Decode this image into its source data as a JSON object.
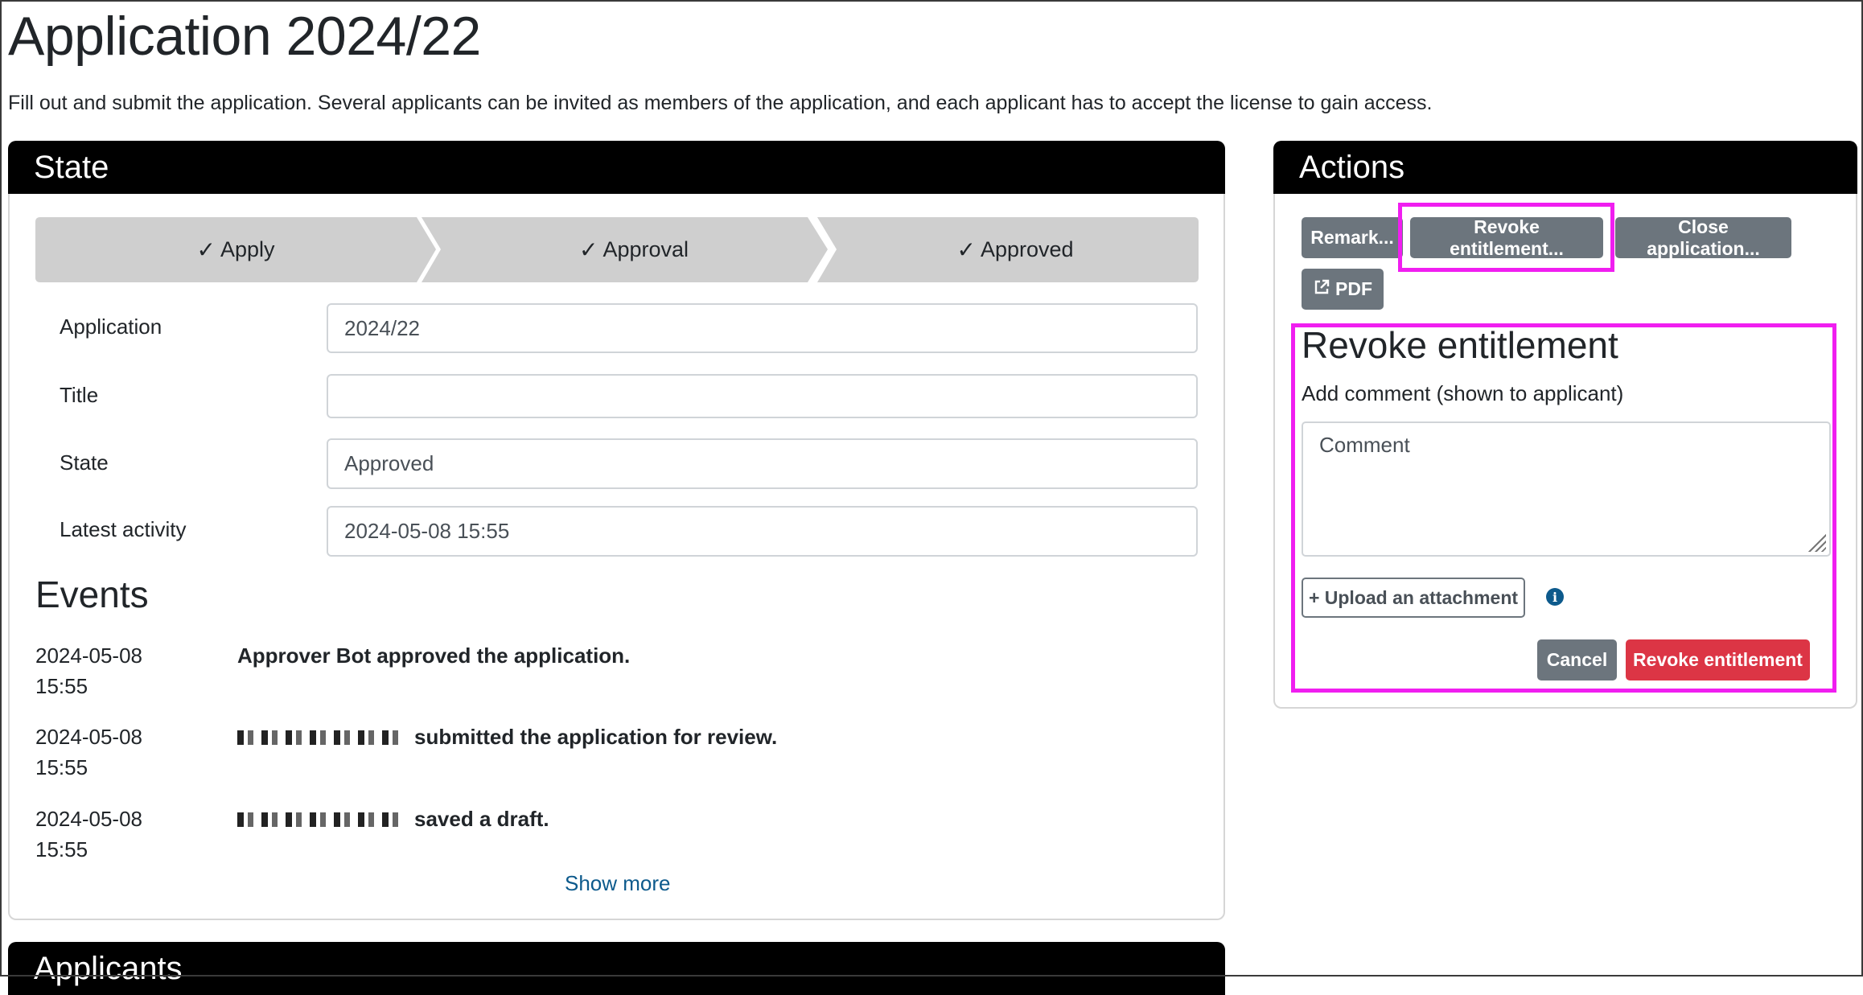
{
  "page": {
    "title": "Application 2024/22",
    "intro": "Fill out and submit the application. Several applicants can be invited as members of the application, and each applicant has to accept the license to gain access."
  },
  "state": {
    "header": "State",
    "phases": [
      {
        "label": "Apply",
        "icon": "check-icon"
      },
      {
        "label": "Approval",
        "icon": "check-icon"
      },
      {
        "label": "Approved",
        "icon": "check-icon"
      }
    ],
    "fields": [
      {
        "label": "Application",
        "value": "2024/22"
      },
      {
        "label": "Title",
        "value": ""
      },
      {
        "label": "State",
        "value": "Approved"
      },
      {
        "label": "Latest activity",
        "value": "2024-05-08 15:55"
      }
    ]
  },
  "events": {
    "title": "Events",
    "items": [
      {
        "date": "2024-05-08",
        "time": "15:55",
        "text": "Approver Bot approved the application."
      },
      {
        "date": "2024-05-08",
        "time": "15:55",
        "text": "submitted the application for review."
      },
      {
        "date": "2024-05-08",
        "time": "15:55",
        "text": "saved a draft."
      }
    ],
    "show_more": "Show more"
  },
  "applicants": {
    "header": "Applicants"
  },
  "actions": {
    "header": "Actions",
    "buttons": {
      "remark": "Remark...",
      "revoke": "Revoke entitlement...",
      "close": "Close application...",
      "pdf": "PDF"
    },
    "revoke_form": {
      "title": "Revoke entitlement",
      "subtitle": "Add comment (shown to applicant)",
      "comment_placeholder": "Comment",
      "upload": "+ Upload an attachment",
      "cancel": "Cancel",
      "submit": "Revoke entitlement"
    }
  },
  "colors": {
    "highlight": "#f01ef0",
    "danger": "#dc3545",
    "secondary": "#6c757d",
    "link": "#0d5a8c"
  }
}
